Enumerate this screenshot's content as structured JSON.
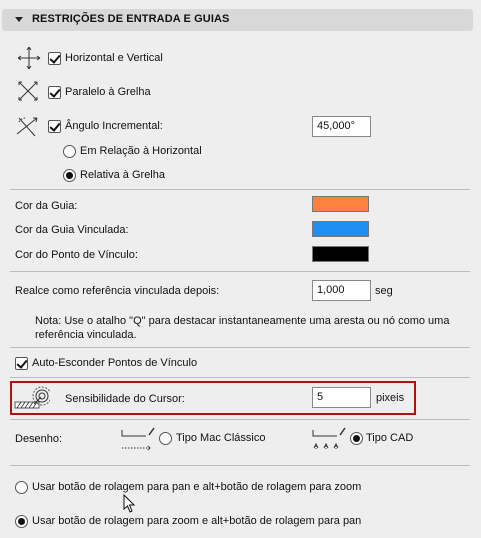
{
  "section": {
    "title": "RESTRIÇÕES DE ENTRADA E GUIAS"
  },
  "constraints": {
    "horizontal_vertical": {
      "label": "Horizontal e Vertical",
      "checked": true,
      "icon": "horizontal-vertical-icon"
    },
    "parallel_grid": {
      "label": "Paralelo à Grelha",
      "checked": true,
      "icon": "parallel-grid-icon"
    },
    "incremental_angle": {
      "label": "Ângulo Incremental:",
      "checked": true,
      "value": "45,000°",
      "icon": "incremental-angle-icon"
    },
    "angle_reference": {
      "options": [
        {
          "label": "Em Relação à Horizontal",
          "selected": false
        },
        {
          "label": "Relativa à Grelha",
          "selected": true
        }
      ]
    }
  },
  "colors": {
    "guide": {
      "label": "Cor da Guia:",
      "color": "#ff8040"
    },
    "linked_guide": {
      "label": "Cor da Guia Vinculada:",
      "color": "#1e8ff0"
    },
    "link_point": {
      "label": "Cor do Ponto de Vínculo:",
      "color": "#000000"
    }
  },
  "highlight_delay": {
    "label": "Realce como referência vinculada depois:",
    "value": "1,000",
    "unit": "seg"
  },
  "note": "Nota: Use o atalho \"Q\" para destacar instantaneamente uma aresta ou nó como uma referência vinculada.",
  "auto_hide": {
    "label": "Auto-Esconder Pontos de Vínculo",
    "checked": true
  },
  "cursor_sensitivity": {
    "label": "Sensibilidade do Cursor:",
    "value": "5",
    "unit": "pixeis",
    "icon": "cursor-sensitivity-icon"
  },
  "drawing": {
    "label": "Desenho:",
    "options": [
      {
        "label": "Tipo Mac Clássico",
        "selected": false,
        "icon": "mac-classic-drawing-icon"
      },
      {
        "label": "Tipo CAD",
        "selected": true,
        "icon": "cad-drawing-icon"
      }
    ]
  },
  "scroll_wheel": {
    "options": [
      {
        "label": "Usar botão de rolagem para pan e alt+botão de rolagem para zoom",
        "selected": false
      },
      {
        "label": "Usar botão de rolagem para zoom e alt+botão de rolagem para pan",
        "selected": true
      }
    ]
  }
}
